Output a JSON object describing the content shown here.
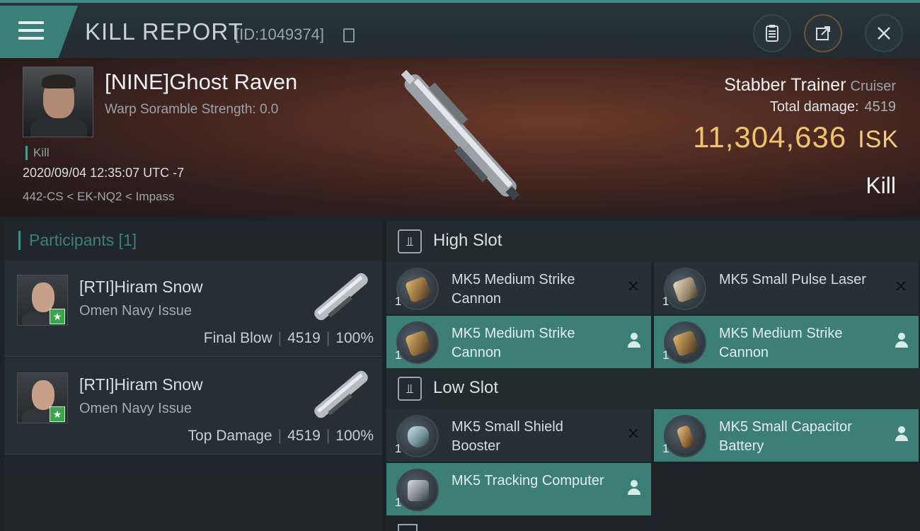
{
  "header": {
    "title": "KILL REPORT",
    "report_id": "[ID:1049374]"
  },
  "victim": {
    "name": "[NINE]Ghost Raven",
    "scramble": "Warp Soramble Strength: 0.0",
    "kill_tag": "Kill",
    "datetime": "2020/09/04 12:35:07 UTC -7",
    "location": "442-CS < EK-NQ2 < Impass",
    "ship_name": "Stabber Trainer",
    "ship_class": "Cruiser",
    "total_damage_label": "Total damage:",
    "total_damage": "4519",
    "isk_value": "11,304,636",
    "isk_unit": "ISK",
    "result": "Kill"
  },
  "participants": {
    "header": "Participants [1]",
    "rows": [
      {
        "name": "[RTI]Hiram Snow",
        "ship": "Omen Navy Issue",
        "role": "Final Blow",
        "damage": "4519",
        "percent": "100%"
      },
      {
        "name": "[RTI]Hiram Snow",
        "ship": "Omen Navy Issue",
        "role": "Top Damage",
        "damage": "4519",
        "percent": "100%"
      }
    ]
  },
  "fitting": {
    "high_slot": {
      "label": "High Slot",
      "modules": [
        {
          "name": "MK5 Medium Strike Cannon",
          "qty": "1",
          "status": "destroyed"
        },
        {
          "name": "MK5 Small Pulse Laser",
          "qty": "1",
          "status": "destroyed"
        },
        {
          "name": "MK5 Medium Strike Cannon",
          "qty": "1",
          "status": "dropped"
        },
        {
          "name": "MK5 Medium Strike Cannon",
          "qty": "1",
          "status": "dropped"
        }
      ]
    },
    "low_slot": {
      "label": "Low Slot",
      "modules": [
        {
          "name": "MK5 Small Shield Booster",
          "qty": "1",
          "status": "destroyed"
        },
        {
          "name": "MK5 Small Capacitor Battery",
          "qty": "1",
          "status": "dropped"
        },
        {
          "name": "MK5 Tracking Computer",
          "qty": "1",
          "status": "dropped"
        }
      ]
    }
  },
  "colors": {
    "accent": "#3f8f86",
    "dropped_bg": "#3b7f77",
    "isk": "#f0c46a"
  }
}
